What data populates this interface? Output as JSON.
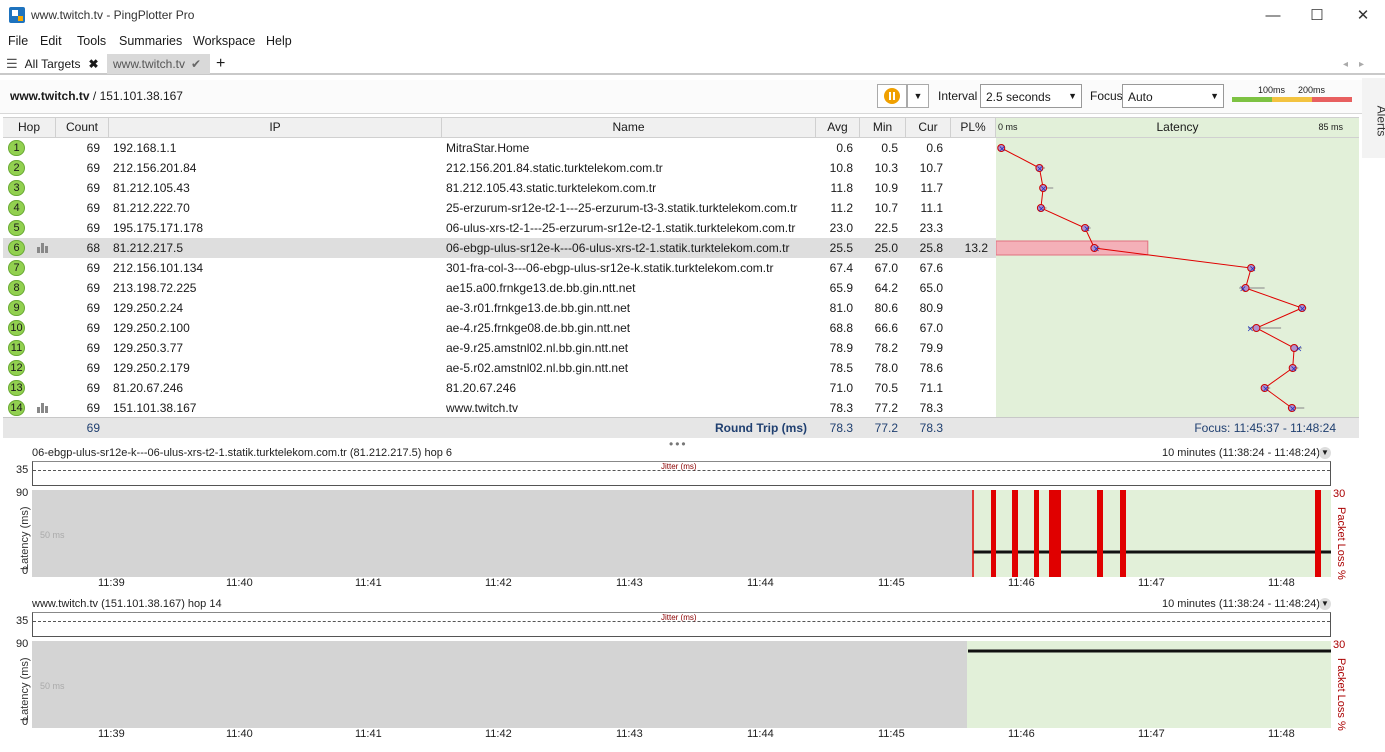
{
  "window": {
    "title": "www.twitch.tv - PingPlotter Pro",
    "minimize": "—",
    "maximize": "☐",
    "close": "✕"
  },
  "menu": [
    "File",
    "Edit",
    "Tools",
    "Summaries",
    "Workspace",
    "Help"
  ],
  "tabs": {
    "all_targets": "All Targets",
    "active": "www.twitch.tv",
    "add": "+"
  },
  "target": {
    "host": "www.twitch.tv",
    "ip": " / 151.101.38.167"
  },
  "controls": {
    "interval_label": "Interval",
    "interval_value": "2.5 seconds",
    "focus_label": "Focus",
    "focus_value": "Auto",
    "legend_100": "100ms",
    "legend_200": "200ms",
    "alerts": "Alerts"
  },
  "columns": {
    "hop": "Hop",
    "count": "Count",
    "ip": "IP",
    "name": "Name",
    "avg": "Avg",
    "min": "Min",
    "cur": "Cur",
    "pl": "PL%",
    "latency": "Latency",
    "lat_min": "0 ms",
    "lat_max": "85 ms"
  },
  "hops": [
    {
      "hop": "1",
      "count": "69",
      "ip": "192.168.1.1",
      "name": "MitraStar.Home",
      "avg": "0.6",
      "min": "0.5",
      "cur": "0.6",
      "pl": ""
    },
    {
      "hop": "2",
      "count": "69",
      "ip": "212.156.201.84",
      "name": "212.156.201.84.static.turktelekom.com.tr",
      "avg": "10.8",
      "min": "10.3",
      "cur": "10.7",
      "pl": ""
    },
    {
      "hop": "3",
      "count": "69",
      "ip": "81.212.105.43",
      "name": "81.212.105.43.static.turktelekom.com.tr",
      "avg": "11.8",
      "min": "10.9",
      "cur": "11.7",
      "pl": ""
    },
    {
      "hop": "4",
      "count": "69",
      "ip": "81.212.222.70",
      "name": "25-erzurum-sr12e-t2-1---25-erzurum-t3-3.statik.turktelekom.com.tr",
      "avg": "11.2",
      "min": "10.7",
      "cur": "11.1",
      "pl": ""
    },
    {
      "hop": "5",
      "count": "69",
      "ip": "195.175.171.178",
      "name": "06-ulus-xrs-t2-1---25-erzurum-sr12e-t2-1.statik.turktelekom.com.tr",
      "avg": "23.0",
      "min": "22.5",
      "cur": "23.3",
      "pl": ""
    },
    {
      "hop": "6",
      "count": "68",
      "ip": "81.212.217.5",
      "name": "06-ebgp-ulus-sr12e-k---06-ulus-xrs-t2-1.statik.turktelekom.com.tr",
      "avg": "25.5",
      "min": "25.0",
      "cur": "25.8",
      "pl": "13.2"
    },
    {
      "hop": "7",
      "count": "69",
      "ip": "212.156.101.134",
      "name": "301-fra-col-3---06-ebgp-ulus-sr12e-k.statik.turktelekom.com.tr",
      "avg": "67.4",
      "min": "67.0",
      "cur": "67.6",
      "pl": ""
    },
    {
      "hop": "8",
      "count": "69",
      "ip": "213.198.72.225",
      "name": "ae15.a00.frnkge13.de.bb.gin.ntt.net",
      "avg": "65.9",
      "min": "64.2",
      "cur": "65.0",
      "pl": ""
    },
    {
      "hop": "9",
      "count": "69",
      "ip": "129.250.2.24",
      "name": "ae-3.r01.frnkge13.de.bb.gin.ntt.net",
      "avg": "81.0",
      "min": "80.6",
      "cur": "80.9",
      "pl": ""
    },
    {
      "hop": "10",
      "count": "69",
      "ip": "129.250.2.100",
      "name": "ae-4.r25.frnkge08.de.bb.gin.ntt.net",
      "avg": "68.8",
      "min": "66.6",
      "cur": "67.0",
      "pl": ""
    },
    {
      "hop": "11",
      "count": "69",
      "ip": "129.250.3.77",
      "name": "ae-9.r25.amstnl02.nl.bb.gin.ntt.net",
      "avg": "78.9",
      "min": "78.2",
      "cur": "79.9",
      "pl": ""
    },
    {
      "hop": "12",
      "count": "69",
      "ip": "129.250.2.179",
      "name": "ae-5.r02.amstnl02.nl.bb.gin.ntt.net",
      "avg": "78.5",
      "min": "78.0",
      "cur": "78.6",
      "pl": ""
    },
    {
      "hop": "13",
      "count": "69",
      "ip": "81.20.67.246",
      "name": "81.20.67.246",
      "avg": "71.0",
      "min": "70.5",
      "cur": "71.1",
      "pl": ""
    },
    {
      "hop": "14",
      "count": "69",
      "ip": "151.101.38.167",
      "name": "www.twitch.tv",
      "avg": "78.3",
      "min": "77.2",
      "cur": "78.3",
      "pl": ""
    }
  ],
  "round_trip": {
    "count": "69",
    "label": "Round Trip (ms)",
    "avg": "78.3",
    "min": "77.2",
    "cur": "78.3",
    "focus": "Focus: 11:45:37 - 11:48:24"
  },
  "graph1": {
    "title": "06-ebgp-ulus-sr12e-k---06-ulus-xrs-t2-1.statik.turktelekom.com.tr (81.212.217.5) hop 6",
    "range": "10 minutes (11:38:24 - 11:48:24)",
    "jitter": "Jitter (ms)",
    "jitter_max": "35",
    "y_max": "90",
    "y_mid": "50 ms",
    "y_min": "0",
    "y_label": "Latency (ms)",
    "pl_max": "30",
    "pl_label": "Packet Loss %"
  },
  "graph2": {
    "title": "www.twitch.tv (151.101.38.167) hop 14",
    "range": "10 minutes (11:38:24 - 11:48:24)",
    "jitter": "Jitter (ms)",
    "jitter_max": "35",
    "y_max": "90",
    "y_mid": "50 ms",
    "y_min": "0",
    "y_label": "Latency (ms)",
    "pl_max": "30",
    "pl_label": "Packet Loss %"
  },
  "time_ticks": [
    "11:39",
    "11:40",
    "11:41",
    "11:42",
    "11:43",
    "11:44",
    "11:45",
    "11:46",
    "11:47",
    "11:48"
  ],
  "colors": {
    "green": "#92d050",
    "red": "#e00000",
    "plot_gray": "#d4d4d4",
    "plot_green": "#e2f0d9",
    "accent": "#f0a000"
  }
}
